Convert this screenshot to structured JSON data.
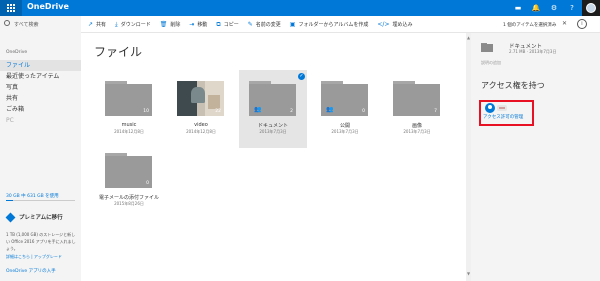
{
  "app": {
    "title": "OneDrive"
  },
  "topbar_icons": [
    "chat-icon",
    "bell-icon",
    "gear-icon",
    "help-icon",
    "avatar"
  ],
  "topbar_glyphs": {
    "chat": "▬",
    "bell": "🔔",
    "gear": "⚙",
    "help": "?"
  },
  "search": {
    "placeholder": "すべて検索"
  },
  "commands": [
    {
      "icon": "share-icon",
      "glyph": "↗",
      "label": "共有"
    },
    {
      "icon": "download-icon",
      "glyph": "⤓",
      "label": "ダウンロード"
    },
    {
      "icon": "delete-icon",
      "glyph": "🗑",
      "label": "削除"
    },
    {
      "icon": "move-icon",
      "glyph": "⇥",
      "label": "移動"
    },
    {
      "icon": "copy-icon",
      "glyph": "⧉",
      "label": "コピー"
    },
    {
      "icon": "rename-icon",
      "glyph": "✎",
      "label": "名前の変更"
    },
    {
      "icon": "album-icon",
      "glyph": "▣",
      "label": "フォルダーからアルバムを作成"
    },
    {
      "icon": "embed-icon",
      "glyph": "</>",
      "label": "埋め込み"
    }
  ],
  "selection": {
    "status": "1 個のアイテムを選択済み",
    "clear_glyph": "✕",
    "info_glyph": "i"
  },
  "sidebar": {
    "title": "OneDrive",
    "items": [
      {
        "label": "ファイル",
        "active": true
      },
      {
        "label": "最近使ったアイテム"
      },
      {
        "label": "写真"
      },
      {
        "label": "共有"
      },
      {
        "label": "ごみ箱"
      },
      {
        "label": "PC",
        "muted": true
      }
    ],
    "quota": {
      "label": "30 GB 中 631 GB を使用",
      "fraction": 0.1
    },
    "premium": {
      "title": "プレミアムに移行",
      "desc": "1 TB (1,000 GB) のストレージと新しい Office 2016 アプリを手に入れましょう。",
      "link": "詳細はこちら | アップグレード"
    },
    "apps_link": "OneDrive アプリの入手"
  },
  "main": {
    "title": "ファイル",
    "items": [
      {
        "name": "music",
        "date": "2014年12月8日",
        "count": "10",
        "kind": "folder"
      },
      {
        "name": "video",
        "date": "2014年12月8日",
        "count": "22",
        "kind": "photo"
      },
      {
        "name": "ドキュメント",
        "date": "2013年7月3日",
        "count": "2",
        "kind": "folder",
        "shared": true,
        "selected": true
      },
      {
        "name": "公開",
        "date": "2013年7月3日",
        "count": "0",
        "kind": "folder",
        "shared": true
      },
      {
        "name": "画像",
        "date": "2013年7月3日",
        "count": "7",
        "kind": "folder"
      },
      {
        "name": "電子メールの添付ファイル",
        "date": "2015年8月26日",
        "count": "0",
        "kind": "folder"
      }
    ],
    "check_glyph": "✓",
    "share_glyph": "👥"
  },
  "details": {
    "name": "ドキュメント",
    "meta": "2.71 MB · 2013年7月3日",
    "hint": "説明の追加",
    "access_title": "アクセス権を持つ",
    "access_link": "アクセス許可の管理"
  }
}
